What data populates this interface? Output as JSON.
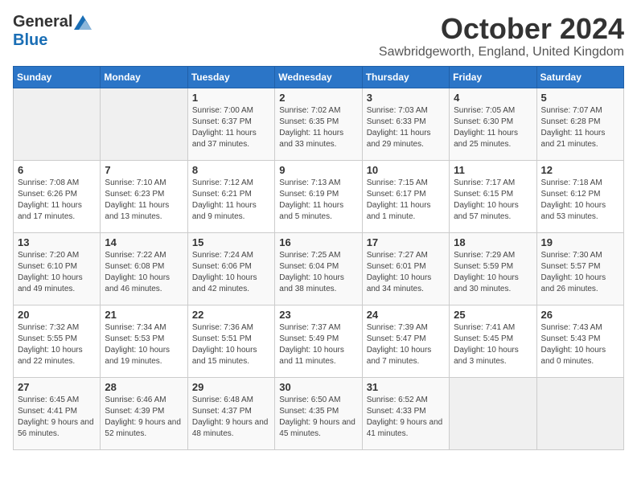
{
  "header": {
    "logo_general": "General",
    "logo_blue": "Blue",
    "month": "October 2024",
    "location": "Sawbridgeworth, England, United Kingdom"
  },
  "days_of_week": [
    "Sunday",
    "Monday",
    "Tuesday",
    "Wednesday",
    "Thursday",
    "Friday",
    "Saturday"
  ],
  "weeks": [
    [
      {
        "day": "",
        "info": ""
      },
      {
        "day": "",
        "info": ""
      },
      {
        "day": "1",
        "info": "Sunrise: 7:00 AM\nSunset: 6:37 PM\nDaylight: 11 hours and 37 minutes."
      },
      {
        "day": "2",
        "info": "Sunrise: 7:02 AM\nSunset: 6:35 PM\nDaylight: 11 hours and 33 minutes."
      },
      {
        "day": "3",
        "info": "Sunrise: 7:03 AM\nSunset: 6:33 PM\nDaylight: 11 hours and 29 minutes."
      },
      {
        "day": "4",
        "info": "Sunrise: 7:05 AM\nSunset: 6:30 PM\nDaylight: 11 hours and 25 minutes."
      },
      {
        "day": "5",
        "info": "Sunrise: 7:07 AM\nSunset: 6:28 PM\nDaylight: 11 hours and 21 minutes."
      }
    ],
    [
      {
        "day": "6",
        "info": "Sunrise: 7:08 AM\nSunset: 6:26 PM\nDaylight: 11 hours and 17 minutes."
      },
      {
        "day": "7",
        "info": "Sunrise: 7:10 AM\nSunset: 6:23 PM\nDaylight: 11 hours and 13 minutes."
      },
      {
        "day": "8",
        "info": "Sunrise: 7:12 AM\nSunset: 6:21 PM\nDaylight: 11 hours and 9 minutes."
      },
      {
        "day": "9",
        "info": "Sunrise: 7:13 AM\nSunset: 6:19 PM\nDaylight: 11 hours and 5 minutes."
      },
      {
        "day": "10",
        "info": "Sunrise: 7:15 AM\nSunset: 6:17 PM\nDaylight: 11 hours and 1 minute."
      },
      {
        "day": "11",
        "info": "Sunrise: 7:17 AM\nSunset: 6:15 PM\nDaylight: 10 hours and 57 minutes."
      },
      {
        "day": "12",
        "info": "Sunrise: 7:18 AM\nSunset: 6:12 PM\nDaylight: 10 hours and 53 minutes."
      }
    ],
    [
      {
        "day": "13",
        "info": "Sunrise: 7:20 AM\nSunset: 6:10 PM\nDaylight: 10 hours and 49 minutes."
      },
      {
        "day": "14",
        "info": "Sunrise: 7:22 AM\nSunset: 6:08 PM\nDaylight: 10 hours and 46 minutes."
      },
      {
        "day": "15",
        "info": "Sunrise: 7:24 AM\nSunset: 6:06 PM\nDaylight: 10 hours and 42 minutes."
      },
      {
        "day": "16",
        "info": "Sunrise: 7:25 AM\nSunset: 6:04 PM\nDaylight: 10 hours and 38 minutes."
      },
      {
        "day": "17",
        "info": "Sunrise: 7:27 AM\nSunset: 6:01 PM\nDaylight: 10 hours and 34 minutes."
      },
      {
        "day": "18",
        "info": "Sunrise: 7:29 AM\nSunset: 5:59 PM\nDaylight: 10 hours and 30 minutes."
      },
      {
        "day": "19",
        "info": "Sunrise: 7:30 AM\nSunset: 5:57 PM\nDaylight: 10 hours and 26 minutes."
      }
    ],
    [
      {
        "day": "20",
        "info": "Sunrise: 7:32 AM\nSunset: 5:55 PM\nDaylight: 10 hours and 22 minutes."
      },
      {
        "day": "21",
        "info": "Sunrise: 7:34 AM\nSunset: 5:53 PM\nDaylight: 10 hours and 19 minutes."
      },
      {
        "day": "22",
        "info": "Sunrise: 7:36 AM\nSunset: 5:51 PM\nDaylight: 10 hours and 15 minutes."
      },
      {
        "day": "23",
        "info": "Sunrise: 7:37 AM\nSunset: 5:49 PM\nDaylight: 10 hours and 11 minutes."
      },
      {
        "day": "24",
        "info": "Sunrise: 7:39 AM\nSunset: 5:47 PM\nDaylight: 10 hours and 7 minutes."
      },
      {
        "day": "25",
        "info": "Sunrise: 7:41 AM\nSunset: 5:45 PM\nDaylight: 10 hours and 3 minutes."
      },
      {
        "day": "26",
        "info": "Sunrise: 7:43 AM\nSunset: 5:43 PM\nDaylight: 10 hours and 0 minutes."
      }
    ],
    [
      {
        "day": "27",
        "info": "Sunrise: 6:45 AM\nSunset: 4:41 PM\nDaylight: 9 hours and 56 minutes."
      },
      {
        "day": "28",
        "info": "Sunrise: 6:46 AM\nSunset: 4:39 PM\nDaylight: 9 hours and 52 minutes."
      },
      {
        "day": "29",
        "info": "Sunrise: 6:48 AM\nSunset: 4:37 PM\nDaylight: 9 hours and 48 minutes."
      },
      {
        "day": "30",
        "info": "Sunrise: 6:50 AM\nSunset: 4:35 PM\nDaylight: 9 hours and 45 minutes."
      },
      {
        "day": "31",
        "info": "Sunrise: 6:52 AM\nSunset: 4:33 PM\nDaylight: 9 hours and 41 minutes."
      },
      {
        "day": "",
        "info": ""
      },
      {
        "day": "",
        "info": ""
      }
    ]
  ]
}
